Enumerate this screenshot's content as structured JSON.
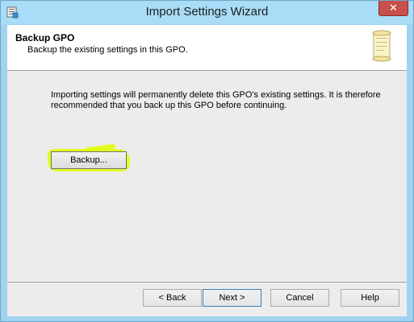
{
  "window": {
    "title": "Import Settings Wizard",
    "close_label": "✕"
  },
  "header": {
    "title": "Backup GPO",
    "subtitle": "Backup the existing settings in this GPO."
  },
  "body": {
    "description": "Importing settings will permanently delete this GPO's existing settings.  It is therefore recommended that you back up this GPO before continuing.",
    "backup_label": "Backup..."
  },
  "footer": {
    "back_label": "< Back",
    "next_label": "Next >",
    "cancel_label": "Cancel",
    "help_label": "Help"
  },
  "colors": {
    "highlight": "#e1ff00",
    "titlebar": "#a8dcf7",
    "close": "#c7504a"
  }
}
